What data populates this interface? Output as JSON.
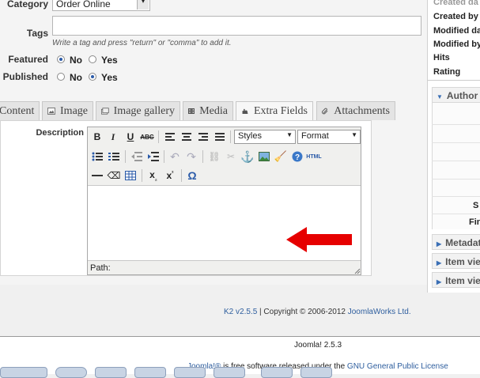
{
  "form": {
    "category_label": "Category",
    "category_value": "Order Online",
    "tags_label": "Tags",
    "tags_hint": "Write a tag and press \"return\" or \"comma\" to add it.",
    "featured_label": "Featured",
    "published_label": "Published",
    "no_label": "No",
    "yes_label": "Yes",
    "featured_value": "No",
    "published_value": "Yes"
  },
  "tabs": [
    {
      "label": "Content",
      "icon": "content-icon"
    },
    {
      "label": "Image",
      "icon": "image-icon"
    },
    {
      "label": "Image gallery",
      "icon": "gallery-icon"
    },
    {
      "label": "Media",
      "icon": "media-icon"
    },
    {
      "label": "Extra Fields",
      "icon": "extra-fields-icon"
    },
    {
      "label": "Attachments",
      "icon": "attachments-icon"
    }
  ],
  "active_tab": "Extra Fields",
  "editor": {
    "field_label": "Description",
    "styles_select": "Styles",
    "format_select": "Format",
    "path_label": "Path:",
    "html_button": "HTML"
  },
  "sidebar": {
    "rows": [
      "Created da",
      "Created by",
      "Modified da",
      "Modified by",
      "Hits",
      "Rating"
    ],
    "panels": [
      "Author p",
      "Metadat",
      "Item vie",
      "Item vie"
    ],
    "partial_labels": [
      "S",
      "Fin"
    ]
  },
  "footer": {
    "k2_version": "K2 v2.5.5",
    "copyright": " | Copyright © 2006-2012 ",
    "company": "JoomlaWorks Ltd.",
    "joomla_version": "Joomla! 2.5.3",
    "joomla_link": "Joomla!®",
    "license_text": " is free software released under the ",
    "license_link": "GNU General Public License"
  },
  "colors": {
    "accent": "#2a5aa8",
    "link": "#2e5e9e",
    "arrow": "#e60000"
  }
}
